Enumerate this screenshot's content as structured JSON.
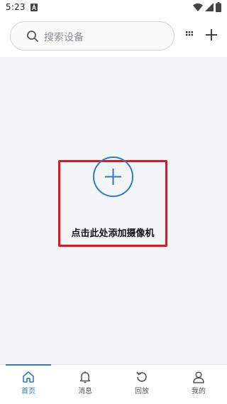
{
  "status_bar": {
    "time": "5:23"
  },
  "header": {
    "search_placeholder": "搜索设备"
  },
  "main": {
    "add_camera_label": "点击此处添加摄像机"
  },
  "bottom_nav": {
    "items": [
      {
        "label": "首页",
        "icon": "home-icon",
        "active": true
      },
      {
        "label": "消息",
        "icon": "bell-icon",
        "active": false
      },
      {
        "label": "回放",
        "icon": "replay-icon",
        "active": false
      },
      {
        "label": "我的",
        "icon": "person-icon",
        "active": false
      }
    ]
  },
  "colors": {
    "accent": "#2f7bc1",
    "highlight_frame": "#e8141d",
    "main_background": "#f3f6f8"
  }
}
